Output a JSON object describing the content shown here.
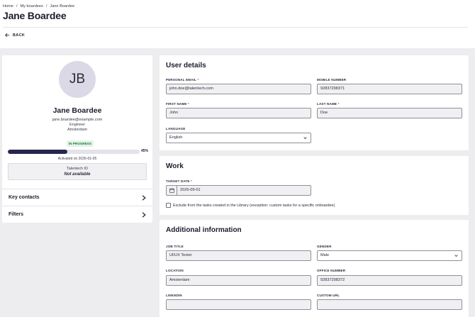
{
  "breadcrumb": [
    "Home",
    "My boardees",
    "Jane Boardee"
  ],
  "page_title": "Jane Boardee",
  "back_label": "BACK",
  "profile": {
    "initials": "JB",
    "name": "Jane Boardee",
    "email": "jane.boardee@example.com",
    "role": "Engineer",
    "location": "Amsterdam",
    "status": "IN PROGRESS",
    "progress_percent": 45,
    "progress_label": "45%",
    "activated": "Activated on 2026-01-05",
    "talentech_id_label": "Talentech ID",
    "talentech_id_value": "Not available",
    "links": [
      "Key contacts",
      "Filters"
    ]
  },
  "user_details": {
    "title": "User details",
    "personal_email_label": "PERSONAL EMAIL",
    "personal_email": "john.doe@talentech.com",
    "mobile_label": "MOBILE NUMBER",
    "mobile": "92837298371",
    "first_name_label": "FIRST NAME",
    "first_name": "John",
    "last_name_label": "LAST NAME",
    "last_name": "Doe",
    "language_label": "LANGUAGE",
    "language": "English"
  },
  "work": {
    "title": "Work",
    "target_date_label": "TARGET DATE",
    "target_date": "2026-09-01",
    "exclude_label": "Exclude from the tasks created in the Library (exception: custom tasks for a specific onboardee)"
  },
  "additional": {
    "title": "Additional information",
    "job_title_label": "JOB TITLE",
    "job_title": "UI/UX Tester",
    "gender_label": "GENDER",
    "gender": "Male",
    "location_label": "LOCATION",
    "location": "Amsterdam",
    "office_number_label": "OFFICE NUMBER",
    "office_number": "92837298372",
    "linkedin_label": "LINKEDIN",
    "linkedin": "",
    "custom_url_label": "CUSTOM URL",
    "custom_url": ""
  },
  "colors": {
    "accent": "#262650",
    "required": "#d43b3b",
    "status_bg": "#e3f3e6",
    "status_text": "#1f7a38"
  },
  "icons": [
    "arrow-left-icon",
    "chevron-right-icon",
    "chevron-down-icon",
    "calendar-icon"
  ]
}
